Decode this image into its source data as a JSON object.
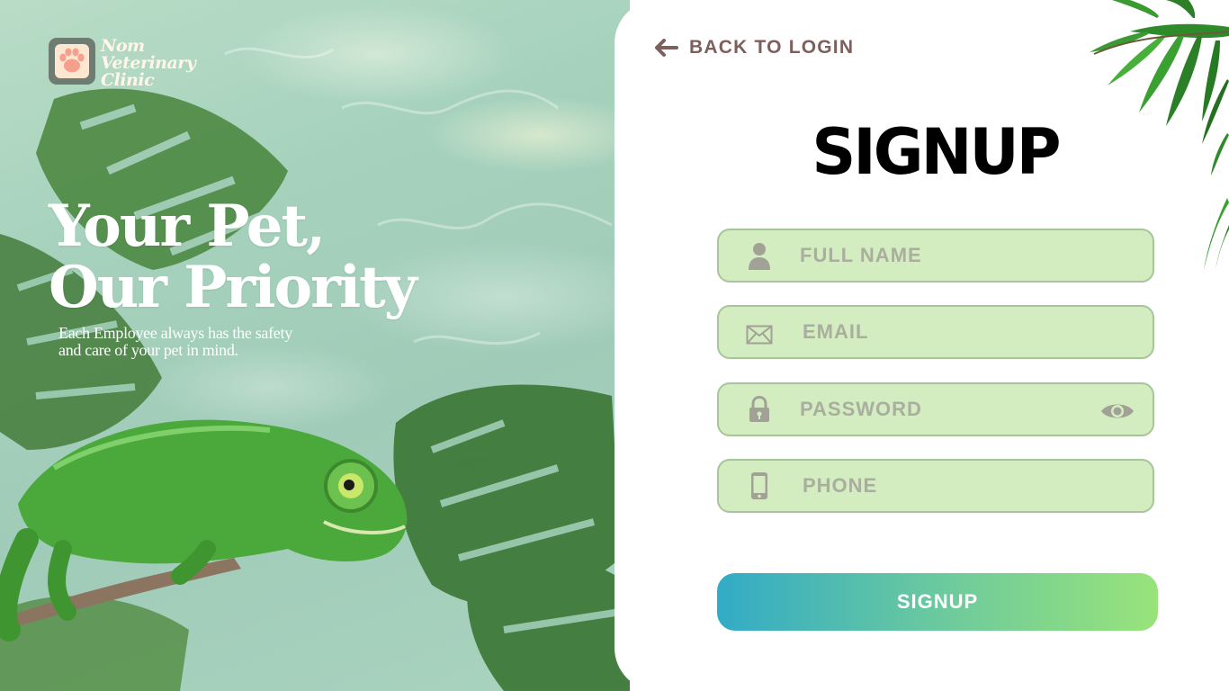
{
  "brand": {
    "line1": "Nom",
    "line2": "Veterinary",
    "line3": "Clinic",
    "icon": "paw-icon"
  },
  "hero": {
    "headline_line1": "Your Pet,",
    "headline_line2": "Our Priority",
    "subtext_line1": "Each Employee always has the safety",
    "subtext_line2": "and care of your pet in mind."
  },
  "nav": {
    "back_label": "BACK TO LOGIN",
    "back_icon": "arrow-left-icon"
  },
  "form": {
    "title": "SIGNUP",
    "fields": [
      {
        "placeholder": "FULL NAME",
        "value": "",
        "icon": "user-icon"
      },
      {
        "placeholder": "EMAIL",
        "value": "",
        "icon": "envelope-icon"
      },
      {
        "placeholder": "PASSWORD",
        "value": "",
        "icon": "lock-icon",
        "toggle_icon": "eye-icon"
      },
      {
        "placeholder": "PHONE",
        "value": "",
        "icon": "phone-icon"
      }
    ],
    "submit_label": "SIGNUP"
  },
  "colors": {
    "field_bg": "#d3edc0",
    "field_border": "#a8c59a",
    "back_text": "#7d5f5d",
    "gradient_start": "#32abc6",
    "gradient_end": "#98e37a"
  }
}
